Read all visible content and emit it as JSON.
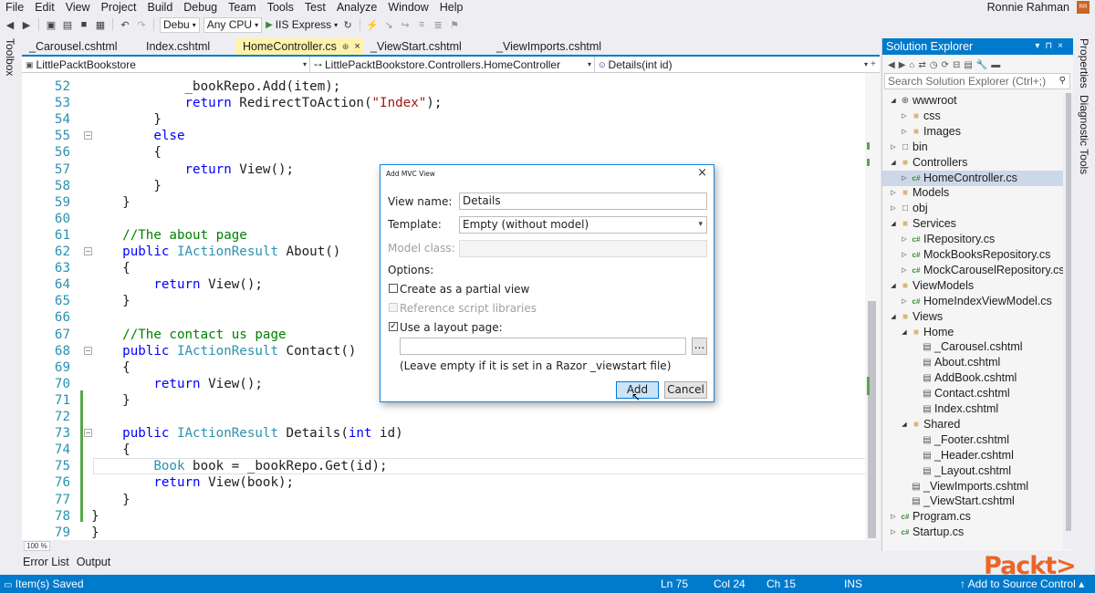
{
  "menu": [
    "File",
    "Edit",
    "View",
    "Project",
    "Build",
    "Debug",
    "Team",
    "Tools",
    "Test",
    "Analyze",
    "Window",
    "Help"
  ],
  "user": {
    "name": "Ronnie Rahman",
    "avatar_text": "RR"
  },
  "toolbar": {
    "config": "Debu",
    "platform": "Any CPU",
    "run_target": "IIS Express"
  },
  "toolbox_label": "Toolbox",
  "doc_tabs": [
    {
      "label": "_Carousel.cshtml",
      "active": false
    },
    {
      "label": "Index.cshtml",
      "active": false
    },
    {
      "label": "HomeController.cs",
      "active": true,
      "pin": "⊕",
      "close": "×"
    },
    {
      "label": "_ViewStart.cshtml",
      "active": false
    },
    {
      "label": "_ViewImports.cshtml",
      "active": false
    }
  ],
  "navbar": {
    "project": "LittlePacktBookstore",
    "class": "LittlePacktBookstore.Controllers.HomeController",
    "member": "Details(int id)"
  },
  "code_lines": [
    {
      "num": "52",
      "text": "            _bookRepo.Add(item);"
    },
    {
      "num": "53",
      "text": "            return RedirectToAction(\"Index\");"
    },
    {
      "num": "54",
      "text": "        }"
    },
    {
      "num": "55",
      "text": "        else"
    },
    {
      "num": "56",
      "text": "        {"
    },
    {
      "num": "57",
      "text": "            return View();"
    },
    {
      "num": "58",
      "text": "        }"
    },
    {
      "num": "59",
      "text": "    }"
    },
    {
      "num": "60",
      "text": ""
    },
    {
      "num": "61",
      "text": "    //The about page"
    },
    {
      "num": "62",
      "text": "    public IActionResult About()"
    },
    {
      "num": "63",
      "text": "    {"
    },
    {
      "num": "64",
      "text": "        return View();"
    },
    {
      "num": "65",
      "text": "    }"
    },
    {
      "num": "66",
      "text": ""
    },
    {
      "num": "67",
      "text": "    //The contact us page"
    },
    {
      "num": "68",
      "text": "    public IActionResult Contact()"
    },
    {
      "num": "69",
      "text": "    {"
    },
    {
      "num": "70",
      "text": "        return View();"
    },
    {
      "num": "71",
      "text": "    }"
    },
    {
      "num": "72",
      "text": ""
    },
    {
      "num": "73",
      "text": "    public IActionResult Details(int id)"
    },
    {
      "num": "74",
      "text": "    {"
    },
    {
      "num": "75",
      "text": "        Book book = _bookRepo.Get(id);"
    },
    {
      "num": "76",
      "text": "        return View(book);"
    },
    {
      "num": "77",
      "text": "    }"
    },
    {
      "num": "78",
      "text": "}"
    },
    {
      "num": "79",
      "text": "}"
    }
  ],
  "zoom": "100 %",
  "dialog": {
    "title": "Add MVC View",
    "close": "×",
    "view_name_label": "View name:",
    "view_name_value": "Details",
    "template_label": "Template:",
    "template_value": "Empty (without model)",
    "model_class_label": "Model class:",
    "options_label": "Options:",
    "partial_label": "Create as a partial view",
    "script_label": "Reference script libraries",
    "layout_label": "Use a layout page:",
    "layout_value": "",
    "browse_label": "...",
    "hint": "(Leave empty if it is set in a Razor _viewstart file)",
    "add_label": "Add",
    "cancel_label": "Cancel",
    "partial_checked": false,
    "script_checked": false,
    "layout_checked": true
  },
  "solution_explorer": {
    "title": "Solution Explorer",
    "search_placeholder": "Search Solution Explorer (Ctrl+;)",
    "items": [
      {
        "label": "wwwroot",
        "depth": 1,
        "icon": "globe",
        "exp": "open"
      },
      {
        "label": "css",
        "depth": 2,
        "icon": "folder",
        "exp": "closed"
      },
      {
        "label": "Images",
        "depth": 2,
        "icon": "folder",
        "exp": "closed"
      },
      {
        "label": "bin",
        "depth": 1,
        "icon": "folder-outline",
        "exp": "closed"
      },
      {
        "label": "Controllers",
        "depth": 1,
        "icon": "folder",
        "exp": "open"
      },
      {
        "label": "HomeController.cs",
        "depth": 2,
        "icon": "cs",
        "exp": "closed",
        "selected": true
      },
      {
        "label": "Models",
        "depth": 1,
        "icon": "folder",
        "exp": "closed"
      },
      {
        "label": "obj",
        "depth": 1,
        "icon": "folder-outline",
        "exp": "closed"
      },
      {
        "label": "Services",
        "depth": 1,
        "icon": "folder",
        "exp": "open"
      },
      {
        "label": "IRepository.cs",
        "depth": 2,
        "icon": "cs",
        "exp": "closed"
      },
      {
        "label": "MockBooksRepository.cs",
        "depth": 2,
        "icon": "cs",
        "exp": "closed"
      },
      {
        "label": "MockCarouselRepository.cs",
        "depth": 2,
        "icon": "cs",
        "exp": "closed"
      },
      {
        "label": "ViewModels",
        "depth": 1,
        "icon": "folder",
        "exp": "open"
      },
      {
        "label": "HomeIndexViewModel.cs",
        "depth": 2,
        "icon": "cs",
        "exp": "closed"
      },
      {
        "label": "Views",
        "depth": 1,
        "icon": "folder",
        "exp": "open"
      },
      {
        "label": "Home",
        "depth": 2,
        "icon": "folder",
        "exp": "open"
      },
      {
        "label": "_Carousel.cshtml",
        "depth": 3,
        "icon": "file",
        "exp": "none"
      },
      {
        "label": "About.cshtml",
        "depth": 3,
        "icon": "file",
        "exp": "none"
      },
      {
        "label": "AddBook.cshtml",
        "depth": 3,
        "icon": "file",
        "exp": "none"
      },
      {
        "label": "Contact.cshtml",
        "depth": 3,
        "icon": "file",
        "exp": "none"
      },
      {
        "label": "Index.cshtml",
        "depth": 3,
        "icon": "file",
        "exp": "none"
      },
      {
        "label": "Shared",
        "depth": 2,
        "icon": "folder",
        "exp": "open"
      },
      {
        "label": "_Footer.cshtml",
        "depth": 3,
        "icon": "file",
        "exp": "none"
      },
      {
        "label": "_Header.cshtml",
        "depth": 3,
        "icon": "file",
        "exp": "none"
      },
      {
        "label": "_Layout.cshtml",
        "depth": 3,
        "icon": "file",
        "exp": "none"
      },
      {
        "label": "_ViewImports.cshtml",
        "depth": 2,
        "icon": "file",
        "exp": "none"
      },
      {
        "label": "_ViewStart.cshtml",
        "depth": 2,
        "icon": "file",
        "exp": "none"
      },
      {
        "label": "Program.cs",
        "depth": 1,
        "icon": "cs",
        "exp": "closed"
      },
      {
        "label": "Startup.cs",
        "depth": 1,
        "icon": "cs",
        "exp": "closed"
      }
    ]
  },
  "right_tabs": [
    "Properties",
    "Diagnostic Tools"
  ],
  "bottom_tabs": [
    "Error List",
    "Output"
  ],
  "status": {
    "message": "Item(s) Saved",
    "ln": "Ln 75",
    "col": "Col 24",
    "ch": "Ch 15",
    "mode": "INS",
    "source_control": "Add to Source Control"
  },
  "watermark": "Packt>",
  "colors": {
    "accent": "#007acc",
    "active_tab": "#fff2ab",
    "keyword": "#0000ff",
    "type": "#2b91af",
    "string": "#a31515",
    "comment": "#008000"
  }
}
